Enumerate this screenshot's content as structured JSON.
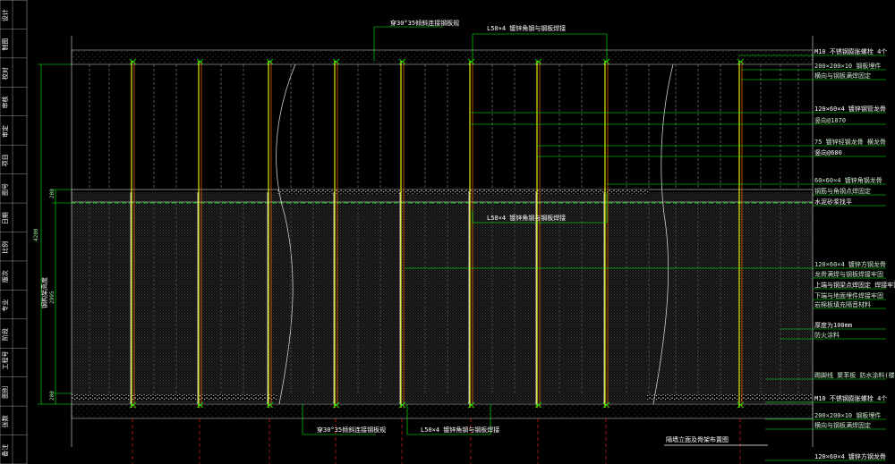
{
  "drawing": {
    "title": "隔墙立面及骨架布置图",
    "top_labels": [
      "穿30°35倾斜连接钢板规",
      "L50×4 镀锌角钢与钢板焊接"
    ],
    "mid_label": "L50×4 镀锌角钢与钢板焊接",
    "bottom_labels": [
      "穿30°35倾斜连接钢板规",
      "L50×4 镀锌角钢与钢板焊接"
    ],
    "right_callouts": [
      "M10 不锈钢膨胀螺栓 4个",
      "200×200×10 钢板埋件",
      "横向与钢板满焊固定",
      "120×60×4 镀锌钢管龙骨",
      "竖向@1070",
      "75 镀锌轻钢龙骨 横龙骨",
      "竖向@600",
      "60×60×4 镀锌角钢龙骨",
      "钢筋与角钢点焊固定",
      "水泥砂浆找平",
      "120×60×4 镀锌方钢龙骨",
      "龙骨满焊与钢板焊接牢固",
      "上端与钢梁点焊固定 焊接牢固",
      "下端与地面埋件焊接牢固",
      "岩棉板填充隔音材料",
      "厚度为100mm",
      "防火涂料",
      "踢脚线 聚苯板 防水涂料(楼地面整体)",
      "M10 不锈钢膨胀螺栓 4个",
      "200×200×10 钢板埋件",
      "横向与钢板满焊固定",
      "120×60×4 镀锌方钢龙骨"
    ],
    "dims_left": [
      "4200",
      "200",
      "2995",
      "200"
    ],
    "vertical_text_left": "钢构架高度",
    "sidebar_rows": [
      "设计",
      "制图",
      "校对",
      "审核",
      "审定",
      "项目",
      "图号",
      "日期",
      "比例",
      "版次",
      "专业",
      "阶段",
      "工程号",
      "图别",
      "张数",
      "备注"
    ]
  },
  "colors": {
    "background": "#000000",
    "green": "#00ff00",
    "yellow": "#ffff00",
    "red": "#ff2020",
    "white": "#ffffff",
    "gray": "#9a9a9a"
  }
}
